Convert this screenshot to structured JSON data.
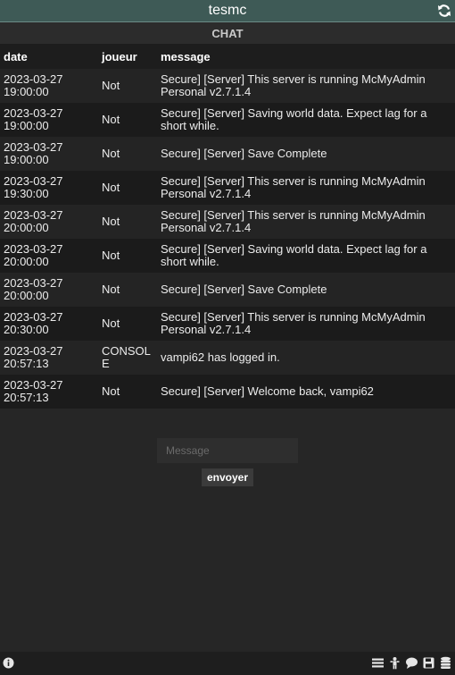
{
  "header": {
    "title": "tesmc",
    "refresh_icon": "refresh-icon"
  },
  "section": {
    "title": "CHAT"
  },
  "table": {
    "columns": [
      "date",
      "joueur",
      "message"
    ],
    "rows": [
      {
        "date": "2023-03-27 19:00:00",
        "player": "Not",
        "message": "Secure] [Server] This server is running McMyAdmin Personal v2.7.1.4"
      },
      {
        "date": "2023-03-27 19:00:00",
        "player": "Not",
        "message": "Secure] [Server] Saving world data. Expect lag for a short while."
      },
      {
        "date": "2023-03-27 19:00:00",
        "player": "Not",
        "message": "Secure] [Server] Save Complete"
      },
      {
        "date": "2023-03-27 19:30:00",
        "player": "Not",
        "message": "Secure] [Server] This server is running McMyAdmin Personal v2.7.1.4"
      },
      {
        "date": "2023-03-27 20:00:00",
        "player": "Not",
        "message": "Secure] [Server] This server is running McMyAdmin Personal v2.7.1.4"
      },
      {
        "date": "2023-03-27 20:00:00",
        "player": "Not",
        "message": "Secure] [Server] Saving world data. Expect lag for a short while."
      },
      {
        "date": "2023-03-27 20:00:00",
        "player": "Not",
        "message": "Secure] [Server] Save Complete"
      },
      {
        "date": "2023-03-27 20:30:00",
        "player": "Not",
        "message": "Secure] [Server] This server is running McMyAdmin Personal v2.7.1.4"
      },
      {
        "date": "2023-03-27 20:57:13",
        "player": "CONSOLE",
        "message": "vampi62 has logged in."
      },
      {
        "date": "2023-03-27 20:57:13",
        "player": "Not",
        "message": "Secure] [Server] Welcome back, vampi62"
      }
    ]
  },
  "composer": {
    "placeholder": "Message",
    "send_label": "envoyer"
  },
  "footer": {
    "left_icon": "info-icon",
    "right_icons": [
      "menu-icon",
      "players-icon",
      "chat-icon",
      "save-icon",
      "database-icon"
    ]
  },
  "colors": {
    "titlebar": "#3e5a56",
    "background": "#262626"
  }
}
